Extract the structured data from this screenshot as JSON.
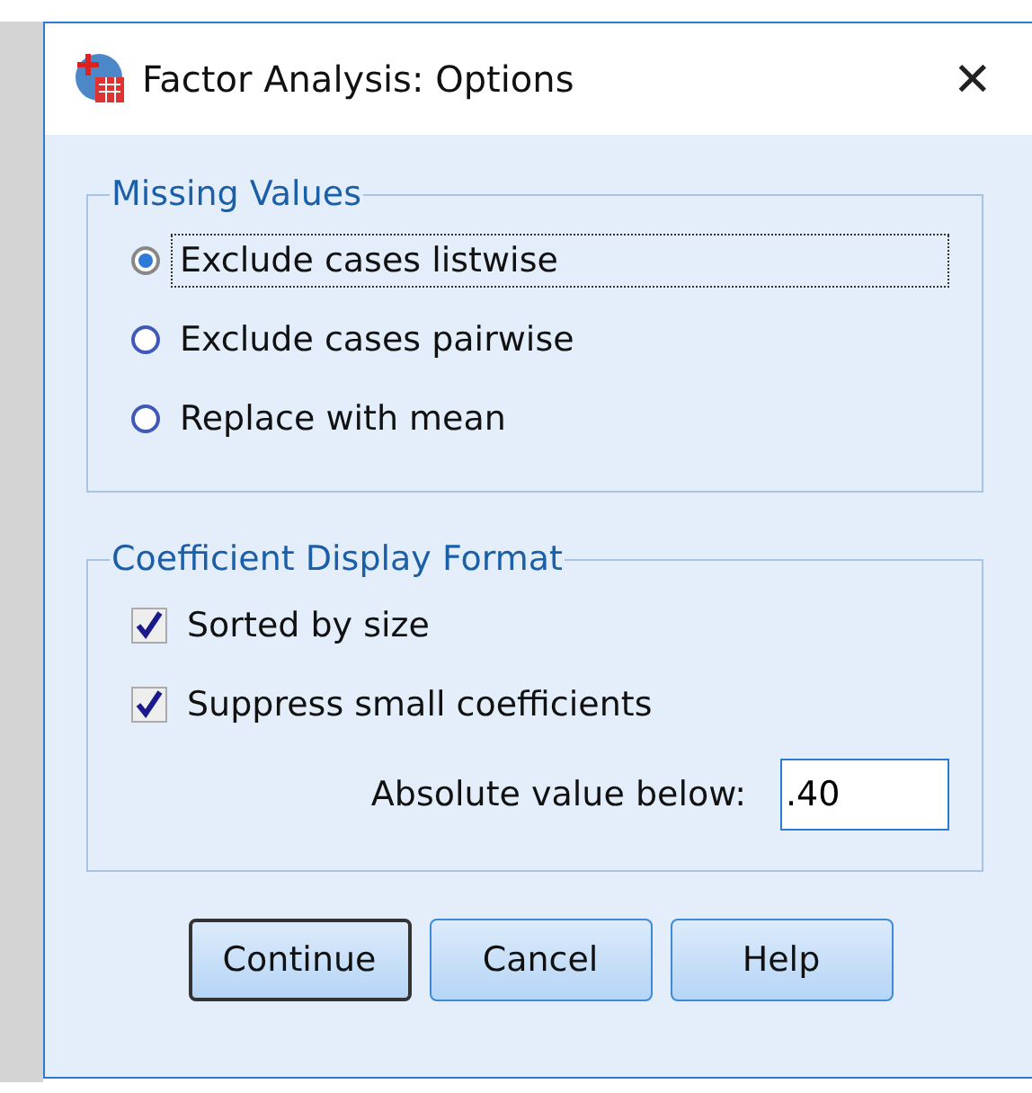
{
  "window": {
    "title": "Factor Analysis: Options",
    "close": "✕"
  },
  "missing_values": {
    "legend": "Missing Values",
    "options": [
      {
        "label": "Exclude cases listwise",
        "selected": true,
        "focused": true
      },
      {
        "label": "Exclude cases pairwise",
        "selected": false,
        "focused": false
      },
      {
        "label": "Replace with mean",
        "selected": false,
        "focused": false
      }
    ]
  },
  "coefficient_display": {
    "legend": "Coefficient Display Format",
    "checkboxes": [
      {
        "label": "Sorted by size",
        "checked": true
      },
      {
        "label": "Suppress small coefficients",
        "checked": true
      }
    ],
    "threshold": {
      "label": "Absolute value below:",
      "value": ".40"
    }
  },
  "buttons": [
    {
      "label": "Continue",
      "default": true
    },
    {
      "label": "Cancel",
      "default": false
    },
    {
      "label": "Help",
      "default": false
    }
  ]
}
